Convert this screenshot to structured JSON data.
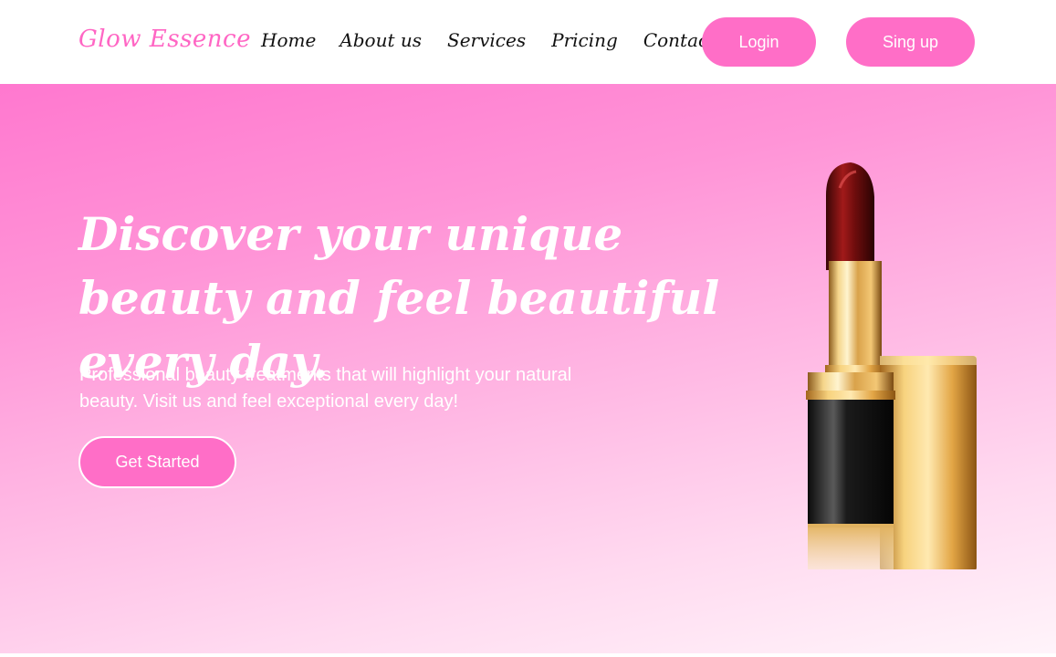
{
  "header": {
    "logo": "Glow Essence",
    "nav": [
      "Home",
      "About us",
      "Services",
      "Pricing",
      "Contact"
    ],
    "login_label": "Login",
    "signup_label": "Sing up"
  },
  "hero": {
    "title": "Discover your unique beauty and feel beautiful every day.",
    "subtitle": "Professional beauty treatments that will highlight your natural beauty. Visit us and feel exceptional every day!",
    "cta_label": "Get Started",
    "image": "lipstick"
  },
  "colors": {
    "accent": "#ff6ec7",
    "hero_gradient_top": "#ff78cf",
    "hero_gradient_bottom": "#fff4fa",
    "text_dark": "#111111",
    "text_light": "#ffffff"
  }
}
